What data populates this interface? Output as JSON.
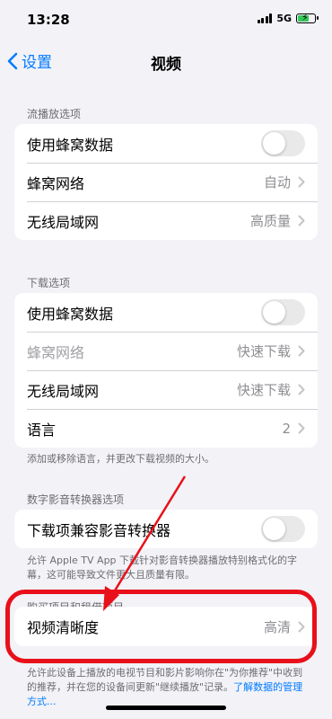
{
  "status_bar": {
    "time": "13:28",
    "network": "5G"
  },
  "nav": {
    "back_label": "设置",
    "title": "视频"
  },
  "streaming": {
    "header": "流播放选项",
    "rows": [
      {
        "label": "使用蜂窝数据",
        "type": "toggle",
        "on": false
      },
      {
        "label": "蜂窝网络",
        "value": "自动"
      },
      {
        "label": "无线局域网",
        "value": "高质量"
      }
    ]
  },
  "downloads": {
    "header": "下载选项",
    "rows": [
      {
        "label": "使用蜂窝数据",
        "type": "toggle",
        "on": false
      },
      {
        "label": "蜂窝网络",
        "value": "快速下载",
        "disabled": true
      },
      {
        "label": "无线局域网",
        "value": "快速下载"
      },
      {
        "label": "语言",
        "value": "2"
      }
    ],
    "footer": "添加或移除语言，并更改下载视频的大小。"
  },
  "converter": {
    "header": "数字影音转换器选项",
    "rows": [
      {
        "label": "下载项兼容影音转换器",
        "type": "toggle",
        "on": false
      }
    ],
    "footer": "允许 Apple TV App 下载针对影音转换器播放特别格式化的字幕，这可能导致文件更大且质量有限。"
  },
  "purchases": {
    "header": "购买项目和租借项目",
    "rows": [
      {
        "label": "视频清晰度",
        "value": "高清"
      }
    ],
    "footer": "允许此设备上播放的电视节目和影片影响你在\"为你推荐\"中收到的推荐，并在您的设备间更新\"继续播放\"记录。",
    "footer_link": "了解数据的管理方式..."
  },
  "colors": {
    "accent": "#007aff",
    "highlight": "#e8101a",
    "battery": "#34c759"
  }
}
